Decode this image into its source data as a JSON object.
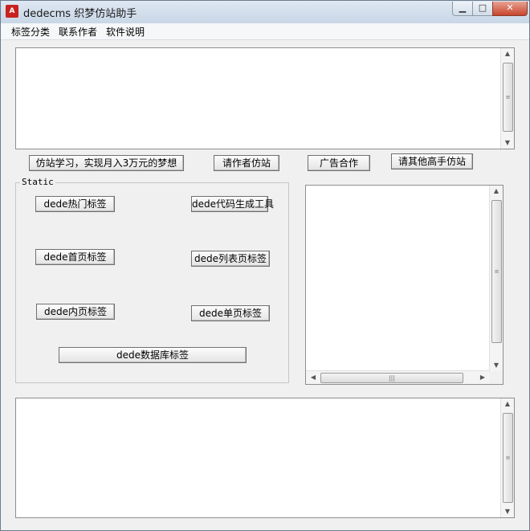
{
  "window": {
    "title": "dedecms 织梦仿站助手",
    "icon_name": "app-logo-icon",
    "icon_text": "A",
    "minimize_glyph": "▁",
    "maximize_glyph": "□",
    "close_glyph": "✕"
  },
  "menu": {
    "items": [
      "标签分类",
      "联系作者",
      "软件说明"
    ]
  },
  "top_textbox": {
    "value": ""
  },
  "action_buttons": [
    "仿站学习，实现月入3万元的梦想",
    "请作者仿站",
    "广告合作",
    "请其他高手仿站"
  ],
  "group": {
    "label": "Static",
    "buttons": [
      "dede热门标签",
      "dede代码生成工具",
      "dede首页标签",
      "dede列表页标签",
      "dede内页标签",
      "dede单页标签",
      "dede数据库标签"
    ]
  },
  "right_list": {
    "items": []
  },
  "bottom_textbox": {
    "value": ""
  },
  "scroll": {
    "up": "▲",
    "down": "▼",
    "left": "◀",
    "right": "▶",
    "grip": "≡",
    "hgrip": "|||"
  }
}
